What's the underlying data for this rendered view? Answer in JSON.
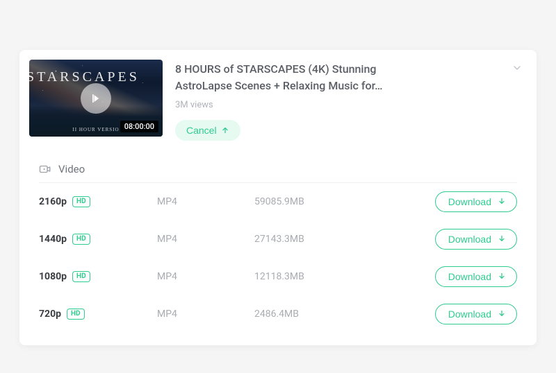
{
  "video": {
    "thumb_title": "STARSCAPES",
    "thumb_sub": "II HOUR VERSIO",
    "duration": "08:00:00",
    "title_line1": "8 HOURS of STARSCAPES (4K) Stunning",
    "title_line2": "AstroLapse Scenes + Relaxing Music for…",
    "views": "3M views",
    "cancel_label": "Cancel"
  },
  "section": {
    "heading": "Video",
    "download_label": "Download",
    "items": [
      {
        "resolution": "2160p",
        "hd": "HD",
        "format": "MP4",
        "size": "59085.9MB"
      },
      {
        "resolution": "1440p",
        "hd": "HD",
        "format": "MP4",
        "size": "27143.3MB"
      },
      {
        "resolution": "1080p",
        "hd": "HD",
        "format": "MP4",
        "size": "12118.3MB"
      },
      {
        "resolution": "720p",
        "hd": "HD",
        "format": "MP4",
        "size": "2486.4MB"
      }
    ]
  }
}
